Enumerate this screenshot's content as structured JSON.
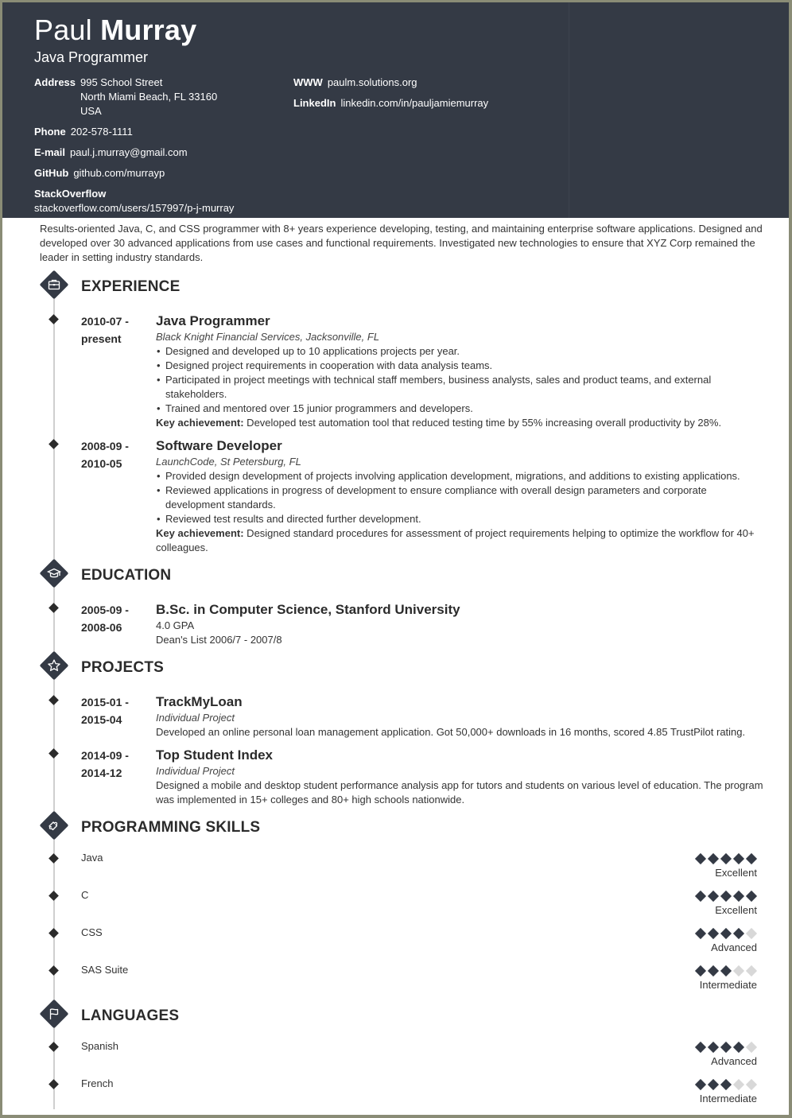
{
  "header": {
    "first_name": "Paul",
    "last_name": "Murray",
    "title": "Java Programmer",
    "address_label": "Address",
    "address_lines": [
      "995 School Street",
      "North Miami Beach, FL 33160",
      "USA"
    ],
    "phone_label": "Phone",
    "phone": "202-578-1111",
    "email_label": "E-mail",
    "email": "paul.j.murray@gmail.com",
    "github_label": "GitHub",
    "github": "github.com/murrayp",
    "stackoverflow_label": "StackOverflow",
    "stackoverflow": "stackoverflow.com/users/157997/p-j-murray",
    "www_label": "WWW",
    "www": "paulm.solutions.org",
    "linkedin_label": "LinkedIn",
    "linkedin": "linkedin.com/in/pauljamiemurray"
  },
  "summary": "Results-oriented Java, C, and CSS programmer with 8+ years experience developing, testing, and maintaining enterprise software applications. Designed and developed over 30 advanced applications from use cases and functional requirements. Investigated new technologies to ensure that XYZ Corp remained the leader in setting industry standards.",
  "colors": {
    "header_bg": "#343a45",
    "accent": "#343a45",
    "inactive": "#d8d8d8",
    "frame": "#8a8c76"
  },
  "sections": {
    "experience": {
      "title": "EXPERIENCE",
      "icon": "briefcase-icon",
      "items": [
        {
          "date_start": "2010-07 -",
          "date_end": "present",
          "title": "Java Programmer",
          "subtitle": "Black Knight Financial Services, Jacksonville, FL",
          "bullets": [
            "Designed and developed up to 10 applications projects per year.",
            "Designed project requirements in cooperation with data analysis teams.",
            "Participated in project meetings with technical staff members, business analysts, sales and product teams, and external stakeholders.",
            "Trained and mentored over 15 junior programmers and developers."
          ],
          "key_label": "Key achievement:",
          "key_text": " Developed test automation tool that reduced testing time by 55% increasing overall productivity by 28%."
        },
        {
          "date_start": "2008-09 -",
          "date_end": "2010-05",
          "title": "Software Developer",
          "subtitle": "LaunchCode, St Petersburg, FL",
          "bullets": [
            "Provided design development of projects involving application development, migrations, and additions to existing applications.",
            "Reviewed applications in progress of development to ensure compliance with overall design parameters and corporate development standards.",
            "Reviewed test results and directed further development."
          ],
          "key_label": "Key achievement:",
          "key_text": " Designed standard procedures for assessment of project requirements helping to optimize the workflow for 40+ colleagues."
        }
      ]
    },
    "education": {
      "title": "EDUCATION",
      "icon": "graduation-cap-icon",
      "items": [
        {
          "date_start": "2005-09 -",
          "date_end": "2008-06",
          "title": "B.Sc. in Computer Science, Stanford University",
          "lines": [
            "4.0 GPA",
            "Dean's List 2006/7 - 2007/8"
          ]
        }
      ]
    },
    "projects": {
      "title": "PROJECTS",
      "icon": "star-icon",
      "items": [
        {
          "date_start": "2015-01 -",
          "date_end": "2015-04",
          "title": "TrackMyLoan",
          "subtitle": "Individual Project",
          "description": "Developed an online personal loan management application. Got 50,000+ downloads in 16 months, scored 4.85 TrustPilot rating."
        },
        {
          "date_start": "2014-09 -",
          "date_end": "2014-12",
          "title": "Top Student Index",
          "subtitle": "Individual Project",
          "description": "Designed a mobile and desktop student performance analysis app for tutors and students on various level of education. The program was implemented in 15+ colleges and 80+ high schools nationwide."
        }
      ]
    },
    "skills": {
      "title": "PROGRAMMING SKILLS",
      "icon": "puzzle-icon",
      "items": [
        {
          "name": "Java",
          "level": 5,
          "max": 5,
          "label": "Excellent"
        },
        {
          "name": "C",
          "level": 5,
          "max": 5,
          "label": "Excellent"
        },
        {
          "name": "CSS",
          "level": 4,
          "max": 5,
          "label": "Advanced"
        },
        {
          "name": "SAS Suite",
          "level": 3,
          "max": 5,
          "label": "Intermediate"
        }
      ]
    },
    "languages": {
      "title": "LANGUAGES",
      "icon": "flag-icon",
      "items": [
        {
          "name": "Spanish",
          "level": 4,
          "max": 5,
          "label": "Advanced"
        },
        {
          "name": "French",
          "level": 3,
          "max": 5,
          "label": "Intermediate"
        }
      ]
    }
  }
}
